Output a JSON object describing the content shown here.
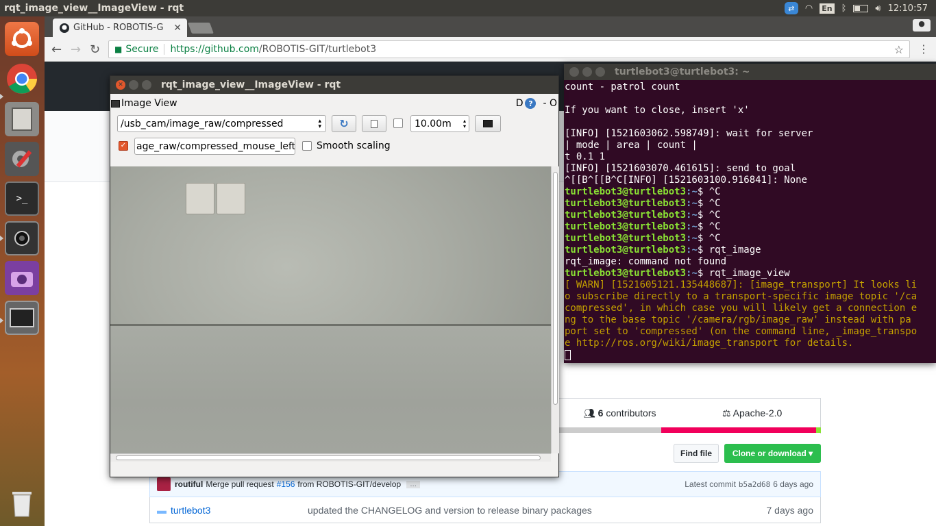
{
  "topbar": {
    "window_title": "rqt_image_view__ImageView - rqt",
    "keyboard_layout": "En",
    "clock": "12:10:57"
  },
  "browser": {
    "tab_title": "GitHub - ROBOTIS-G",
    "tab_close": "✕",
    "secure_label": "Secure",
    "url_scheme_host": "https://github.com",
    "url_path": "/ROBOTIS-GIT/turtlebot3"
  },
  "github": {
    "contributors_count": "6",
    "contributors_label": "contributors",
    "license": "Apache-2.0",
    "find_file": "Find file",
    "clone_download": "Clone or download ▾",
    "commit": {
      "author": "routiful",
      "message_prefix": "Merge pull request",
      "pr_link": "#156",
      "message_suffix": "from ROBOTIS-GIT/develop",
      "ellipsis": "…",
      "latest_label": "Latest commit",
      "sha": "b5a2d68",
      "age": "6 days ago"
    },
    "file": {
      "name": "turtlebot3",
      "message": "updated the CHANGELOG and version to release binary packages",
      "age": "7 days ago"
    },
    "lang_colors": [
      "#cccccc",
      "#f1005b",
      "#8ae234"
    ]
  },
  "rqt": {
    "title": "rqt_image_view__ImageView - rqt",
    "plugin_title": "Image View",
    "header_right_d": "D",
    "header_help": "?",
    "header_right_o": "- O",
    "topic": "/usb_cam/image_raw/compressed",
    "zoom_value": "10.00m",
    "mouse_topic": "age_raw/compressed_mouse_left",
    "smooth_scaling": "Smooth scaling"
  },
  "terminal": {
    "title": "turtlebot3@turtlebot3: ~",
    "user_host": "turtlebot3@turtlebot3",
    "path": ":~",
    "lines_plain_top": [
      "count - patrol count",
      "",
      "If you want to close, insert 'x'",
      "",
      "[INFO] [1521603062.598749]: wait for server",
      "| mode | area | count |",
      "t 0.1 1",
      "[INFO] [1521603070.461615]: send to goal",
      "^[[B^[[B^C[INFO] [1521603100.916841]: None"
    ],
    "cmd_ctrl_c": "$ ^C",
    "cmd_rqt_image": "$ rqt_image",
    "not_found": "rqt_image: command not found",
    "cmd_rqt_image_view": "$ rqt_image_view",
    "warn_lines": [
      "[ WARN] [1521605121.135448687]: [image_transport] It looks li",
      "o subscribe directly to a transport-specific image topic '/ca",
      "compressed', in which case you will likely get a connection e",
      "ng to the base topic '/camera/rgb/image_raw' instead with pa",
      "port set to 'compressed' (on the command line, _image_transpo",
      "e http://ros.org/wiki/image_transport for details."
    ]
  }
}
